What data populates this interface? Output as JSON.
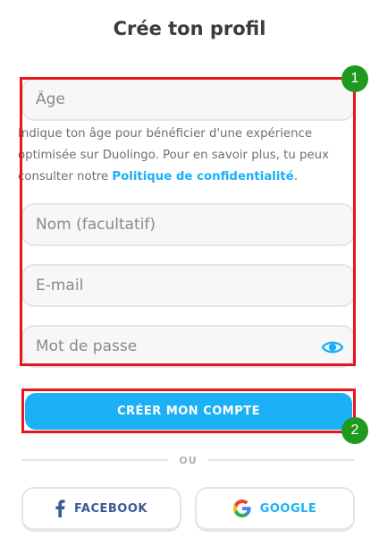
{
  "page": {
    "title": "Crée ton profil"
  },
  "form": {
    "age_placeholder": "Âge",
    "help_text_before_link": "Indique ton âge pour bénéficier d'une expérience optimisée sur Duolingo. Pour en savoir plus, tu peux consulter notre ",
    "help_link_label": "Politique de confidentialité",
    "help_text_after_link": ".",
    "name_placeholder": "Nom (facultatif)",
    "email_placeholder": "E-mail",
    "password_placeholder": "Mot de passe",
    "password_toggle_icon": "eye-icon"
  },
  "actions": {
    "create_account_label": "CRÉER MON COMPTE",
    "divider_label": "OU",
    "facebook_label": "FACEBOOK",
    "google_label": "GOOGLE"
  },
  "annotations": [
    {
      "label": "1"
    },
    {
      "label": "2"
    }
  ],
  "colors": {
    "accent": "#1cb0f6",
    "annotation_border": "#e8141b",
    "annotation_badge": "#1f9a1f",
    "facebook": "#3b5998"
  }
}
